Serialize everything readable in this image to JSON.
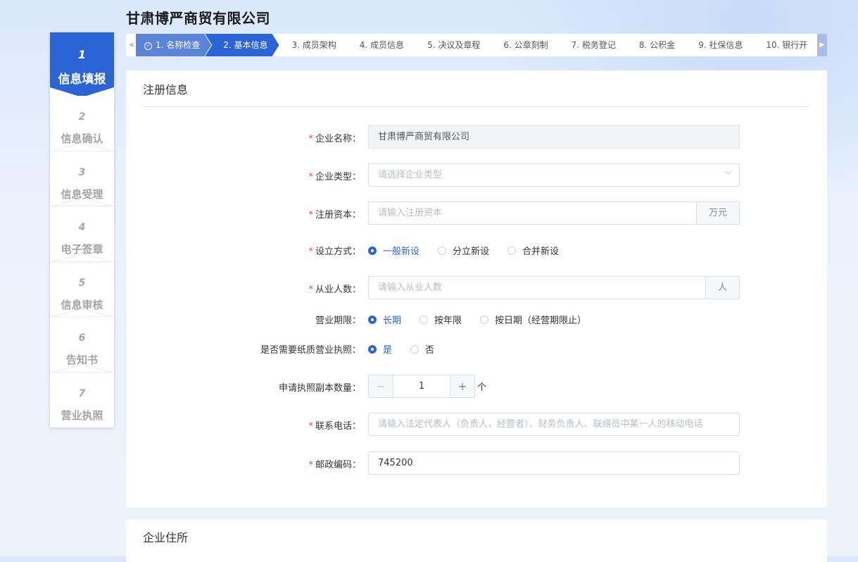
{
  "company_title": "甘肃博严商贸有限公司",
  "side_steps": [
    {
      "num": "1",
      "label": "信息填报",
      "active": true
    },
    {
      "num": "2",
      "label": "信息确认"
    },
    {
      "num": "3",
      "label": "信息受理"
    },
    {
      "num": "4",
      "label": "电子签章"
    },
    {
      "num": "5",
      "label": "信息审核"
    },
    {
      "num": "6",
      "label": "告知书"
    },
    {
      "num": "7",
      "label": "营业执照"
    }
  ],
  "tabs": [
    {
      "label": "1. 名称检查",
      "state": "done"
    },
    {
      "label": "2. 基本信息",
      "state": "current"
    },
    {
      "label": "3. 成员架构"
    },
    {
      "label": "4. 成员信息"
    },
    {
      "label": "5. 决议及章程"
    },
    {
      "label": "6. 公章刻制"
    },
    {
      "label": "7. 税务登记"
    },
    {
      "label": "8. 公积金"
    },
    {
      "label": "9. 社保信息"
    },
    {
      "label": "10. 银行开"
    }
  ],
  "section_registration": {
    "title": "注册信息",
    "company_name": {
      "label": "企业名称：",
      "value": "甘肃博严商贸有限公司"
    },
    "company_type": {
      "label": "企业类型：",
      "placeholder": "请选择企业类型"
    },
    "registered_capital": {
      "label": "注册资本：",
      "placeholder": "请输入注册资本",
      "unit": "万元"
    },
    "establish_method": {
      "label": "设立方式：",
      "options": [
        "一般新设",
        "分立新设",
        "合并新设"
      ],
      "selected": 0
    },
    "employees": {
      "label": "从业人数：",
      "placeholder": "请输入从业人数",
      "unit": "人"
    },
    "business_term": {
      "label": "营业期限：",
      "options": [
        "长期",
        "按年限",
        "按日期（经营期限止）"
      ],
      "selected": 0
    },
    "paper_license": {
      "label": "是否需要纸质营业执照：",
      "options": [
        "是",
        "否"
      ],
      "selected": 0
    },
    "copy_count": {
      "label": "申请执照副本数量：",
      "value": "1",
      "minus": "−",
      "plus": "+",
      "unit": "个"
    },
    "phone": {
      "label": "联系电话：",
      "placeholder": "请输入法定代表人（负责人，经营者）、财务负责人、联络员中某一人的移动电话"
    },
    "postcode": {
      "label": "邮政编码：",
      "value": "745200"
    }
  },
  "section_address": {
    "title": "企业住所"
  },
  "required_mark": "*"
}
